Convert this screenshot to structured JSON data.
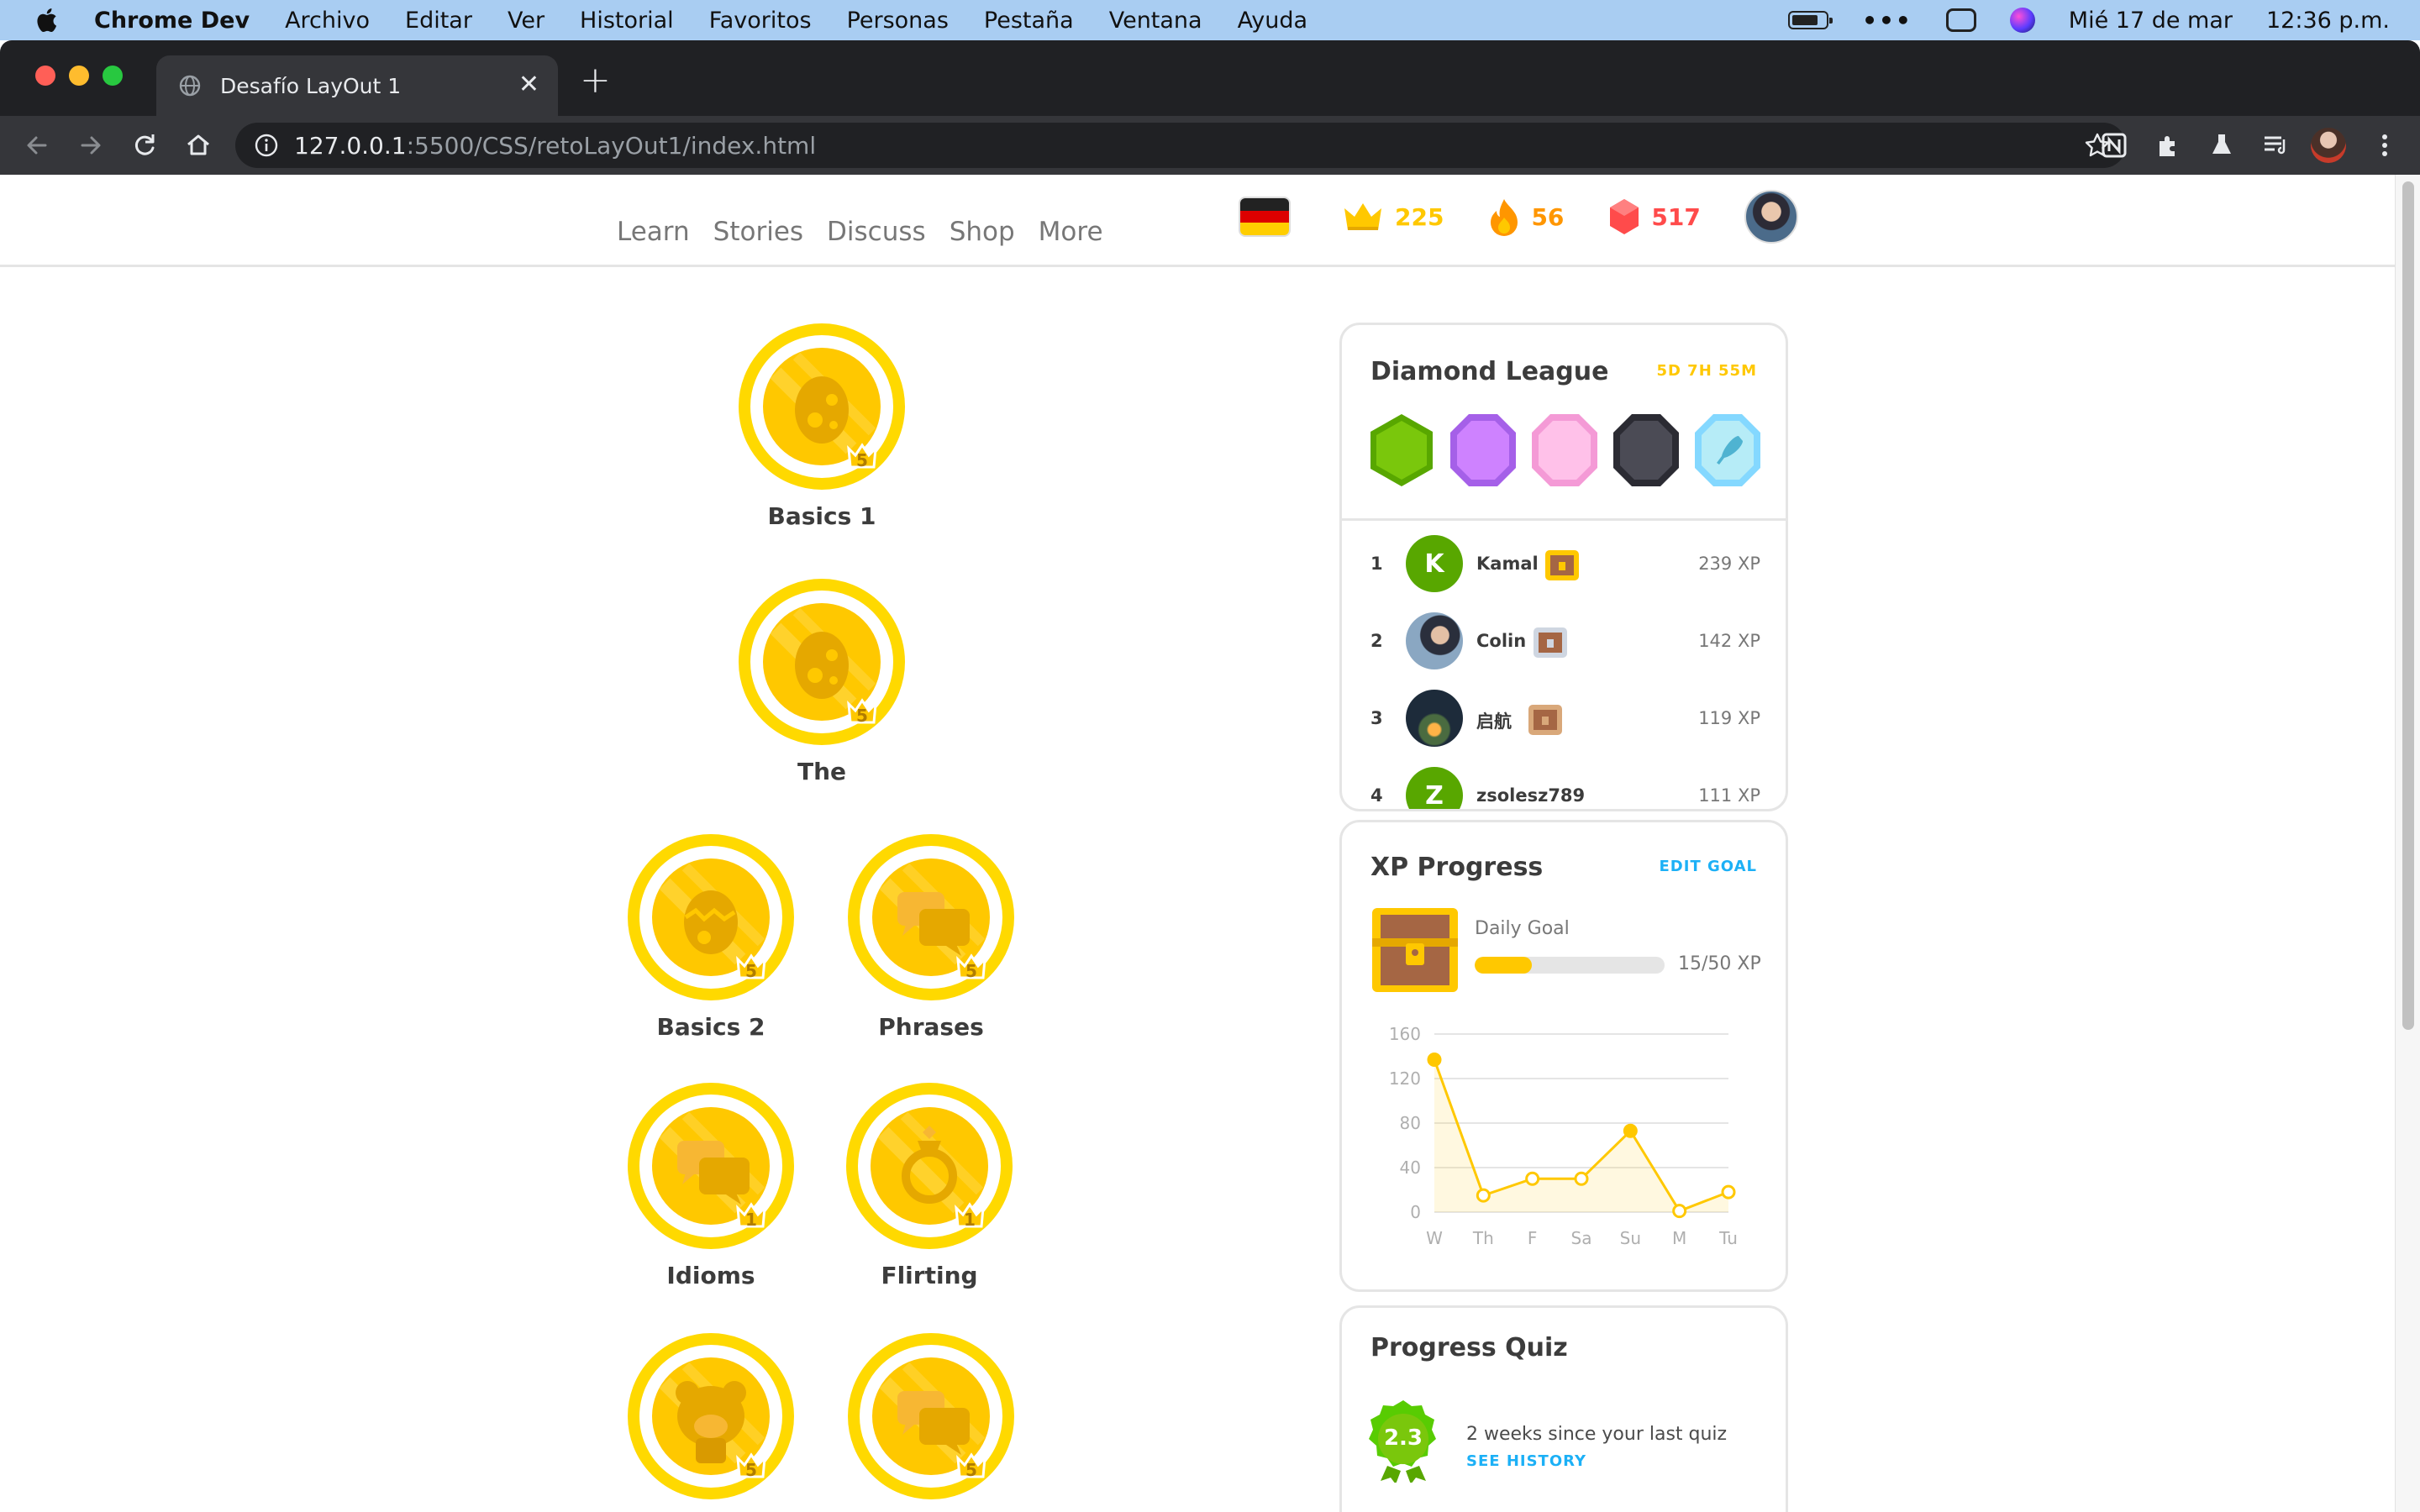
{
  "menubar": {
    "app_name": "Chrome Dev",
    "items": [
      "Archivo",
      "Editar",
      "Ver",
      "Historial",
      "Favoritos",
      "Personas",
      "Pestaña",
      "Ventana",
      "Ayuda"
    ],
    "date": "Mié 17 de mar",
    "time": "12:36 p.m."
  },
  "browser": {
    "tab_title": "Desafío LayOut 1",
    "url_host": "127.0.0.1",
    "url_path": ":5500/CSS/retoLayOut1/index.html"
  },
  "nav": {
    "links": [
      "Learn",
      "Stories",
      "Discuss",
      "Shop",
      "More"
    ],
    "crowns": "225",
    "streak": "56",
    "gems": "517",
    "colors": {
      "crowns": "#ffc800",
      "streak": "#ff9600",
      "gems": "#ff4b4b"
    }
  },
  "skills": [
    {
      "name": "Basics 1",
      "level": "5",
      "icon": "egg-icon"
    },
    {
      "name": "The",
      "level": "5",
      "icon": "egg-icon"
    },
    {
      "name": "Basics 2",
      "level": "5",
      "icon": "cracked-egg-icon"
    },
    {
      "name": "Phrases",
      "level": "5",
      "icon": "speech-bubbles-icon"
    },
    {
      "name": "Idioms",
      "level": "1",
      "icon": "speech-bubbles-icon"
    },
    {
      "name": "Flirting",
      "level": "1",
      "icon": "ring-icon"
    },
    {
      "name": "",
      "level": "5",
      "icon": "bear-icon"
    },
    {
      "name": "",
      "level": "5",
      "icon": "speech-bubbles-icon"
    }
  ],
  "league": {
    "title": "Diamond League",
    "timer": "5D 7H 55M",
    "leaderboard": [
      {
        "rank": "1",
        "initial": "K",
        "name": "Kamal",
        "xp": "239 XP"
      },
      {
        "rank": "2",
        "initial": "",
        "name": "Colin",
        "xp": "142 XP"
      },
      {
        "rank": "3",
        "initial": "",
        "name": "启航",
        "xp": "119 XP"
      },
      {
        "rank": "4",
        "initial": "Z",
        "name": "zsolesz789",
        "xp": "111 XP"
      }
    ]
  },
  "xp_progress": {
    "title": "XP Progress",
    "edit_goal": "EDIT GOAL",
    "daily_goal_label": "Daily Goal",
    "daily_goal_value": "15/50 XP",
    "progress_fraction": 0.3
  },
  "chart_data": {
    "type": "line",
    "categories": [
      "W",
      "Th",
      "F",
      "Sa",
      "Su",
      "M",
      "Tu"
    ],
    "values": [
      137,
      15,
      30,
      30,
      73,
      1,
      18
    ],
    "y_ticks": [
      "0",
      "40",
      "80",
      "120",
      "160"
    ],
    "ylim": [
      0,
      160
    ],
    "grid": true,
    "color": "#ffc800"
  },
  "quiz": {
    "title": "Progress Quiz",
    "score": "2.3",
    "since_text": "2 weeks since your last quiz",
    "history_link": "SEE HISTORY"
  }
}
